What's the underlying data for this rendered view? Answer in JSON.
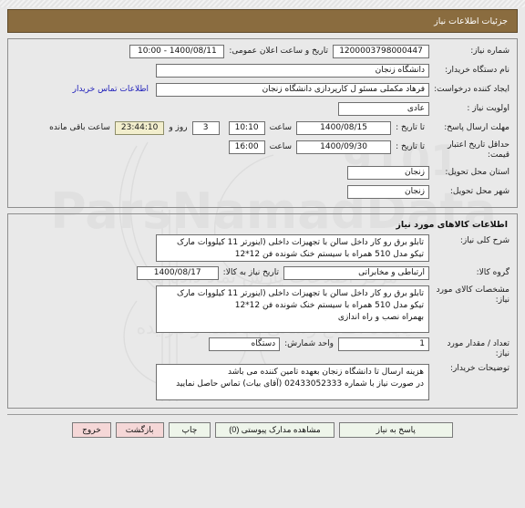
{
  "header": {
    "title": "جزئیات اطلاعات نیاز"
  },
  "request_info": {
    "need_number_label": "شماره نیاز:",
    "need_number_value": "1200003798000447",
    "public_announce_label": "تاریخ و ساعت اعلان عمومی:",
    "public_announce_value": "1400/08/11 - 10:00",
    "buyer_org_label": "نام دستگاه خریدار:",
    "buyer_org_value": "دانشگاه زنجان",
    "creator_label": "ایجاد کننده درخواست:",
    "creator_value": "فرهاد مکملی مسئو ل کارپردازی دانشگاه زنجان",
    "contact_link": "اطلاعات تماس خریدار",
    "priority_label": "اولویت نیاز :",
    "priority_value": "عادی",
    "deadline_label": "مهلت ارسال پاسخ:",
    "until_date_label": "تا تاریخ :",
    "deadline_date": "1400/08/15",
    "hour_label": "ساعت",
    "deadline_time": "10:10",
    "remaining_days": "3",
    "remaining_days_label": "روز و",
    "remaining_timer": "23:44:10",
    "remaining_suffix": "ساعت باقی مانده",
    "price_validity_label": "حداقل تاریخ اعتبار قیمت:",
    "price_validity_until_label": "تا تاریخ :",
    "price_validity_date": "1400/09/30",
    "price_validity_hour_label": "ساعت",
    "price_validity_time": "16:00",
    "province_label": "استان محل تحویل:",
    "province_value": "زنجان",
    "city_label": "شهر محل تحویل:",
    "city_value": "زنجان"
  },
  "goods_info": {
    "section_title": "اطلاعات کالاهای مورد نیاز",
    "general_desc_label": "شرح کلی نیاز:",
    "general_desc_value": "تابلو برق رو کار داخل سالن با تجهیزات داخلی (اینورتر 11 کیلووات مارک تیکو مدل 510 همراه با سیستم خنک شونده فن 12*12",
    "group_label": "گروه کالا:",
    "group_value": "ارتباطی و مخابراتی",
    "need_date_label": "تاریخ نیاز به کالا:",
    "need_date_value": "1400/08/17",
    "specs_label": "مشخصات کالای مورد نیاز:",
    "specs_value": "تابلو برق رو کار داخل سالن با تجهیزات داخلی (اینورتر 11 کیلووات مارک تیکو مدل 510 همراه با سیستم خنک شونده فن 12*12\nبهمراه نصب و راه اندازی",
    "quantity_label": "تعداد / مقدار مورد نیاز:",
    "quantity_value": "1",
    "unit_label": "واحد شمارش:",
    "unit_value": "دستگاه",
    "buyer_notes_label": "توضیحات خریدار:",
    "buyer_notes_value": "هزینه ارسال تا دانشگاه زنجان بعهده تامین کننده می باشد\nدر صورت نیاز با شماره 02433052333 (آقای بیات) تماس حاصل نمایید"
  },
  "actions": {
    "respond": "پاسخ به نیاز",
    "view_attachments": "مشاهده مدارک پیوستی (0)",
    "print": "چاپ",
    "back": "بازگشت",
    "exit": "خروج"
  },
  "colors": {
    "header_bar": "#8a6c3f",
    "link": "#2222bb",
    "timer_bg": "#f2eecd",
    "button_bg": "#eef5ea",
    "danger_button_bg": "#f5d7d7",
    "page_bg": "#e9e9e9"
  }
}
